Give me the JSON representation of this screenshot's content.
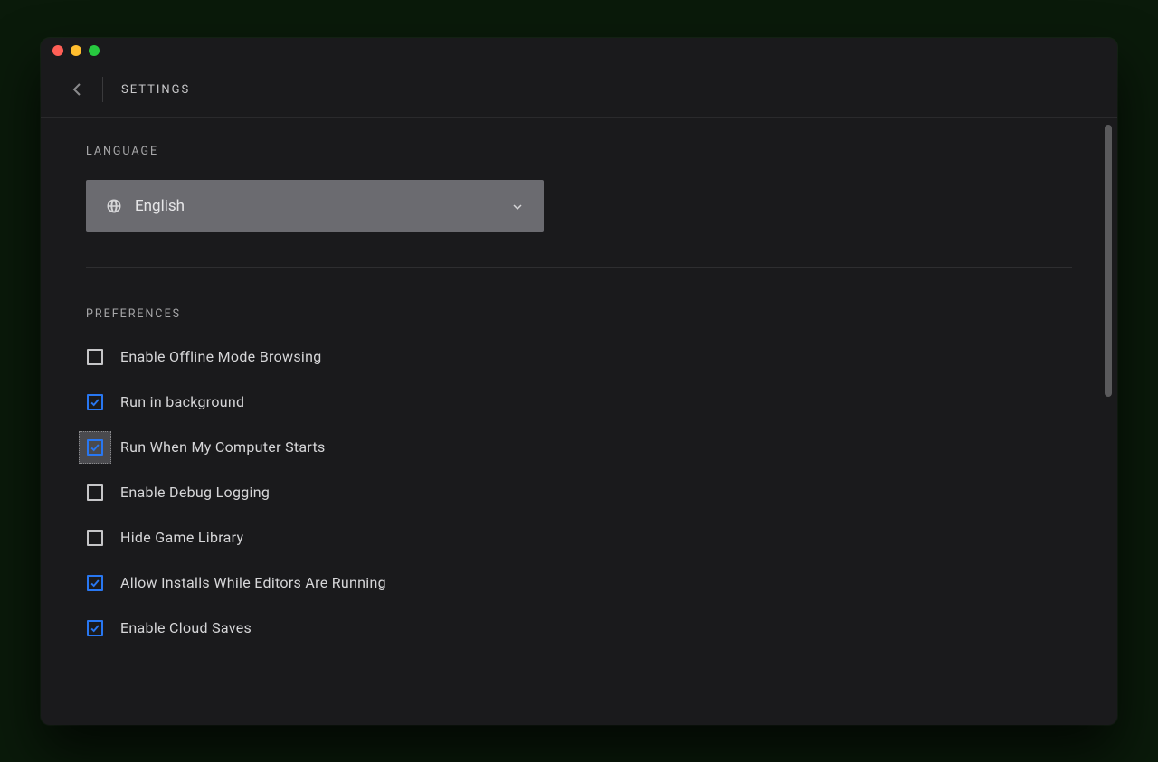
{
  "header": {
    "title": "SETTINGS"
  },
  "sections": {
    "language": {
      "heading": "LANGUAGE",
      "selected": "English"
    },
    "preferences": {
      "heading": "PREFERENCES",
      "items": [
        {
          "label": "Enable Offline Mode Browsing",
          "checked": false,
          "focused": false
        },
        {
          "label": "Run in background",
          "checked": true,
          "focused": false
        },
        {
          "label": "Run When My Computer Starts",
          "checked": true,
          "focused": true
        },
        {
          "label": "Enable Debug Logging",
          "checked": false,
          "focused": false
        },
        {
          "label": "Hide Game Library",
          "checked": false,
          "focused": false
        },
        {
          "label": "Allow Installs While Editors Are Running",
          "checked": true,
          "focused": false
        },
        {
          "label": "Enable Cloud Saves",
          "checked": true,
          "focused": false
        }
      ]
    }
  }
}
